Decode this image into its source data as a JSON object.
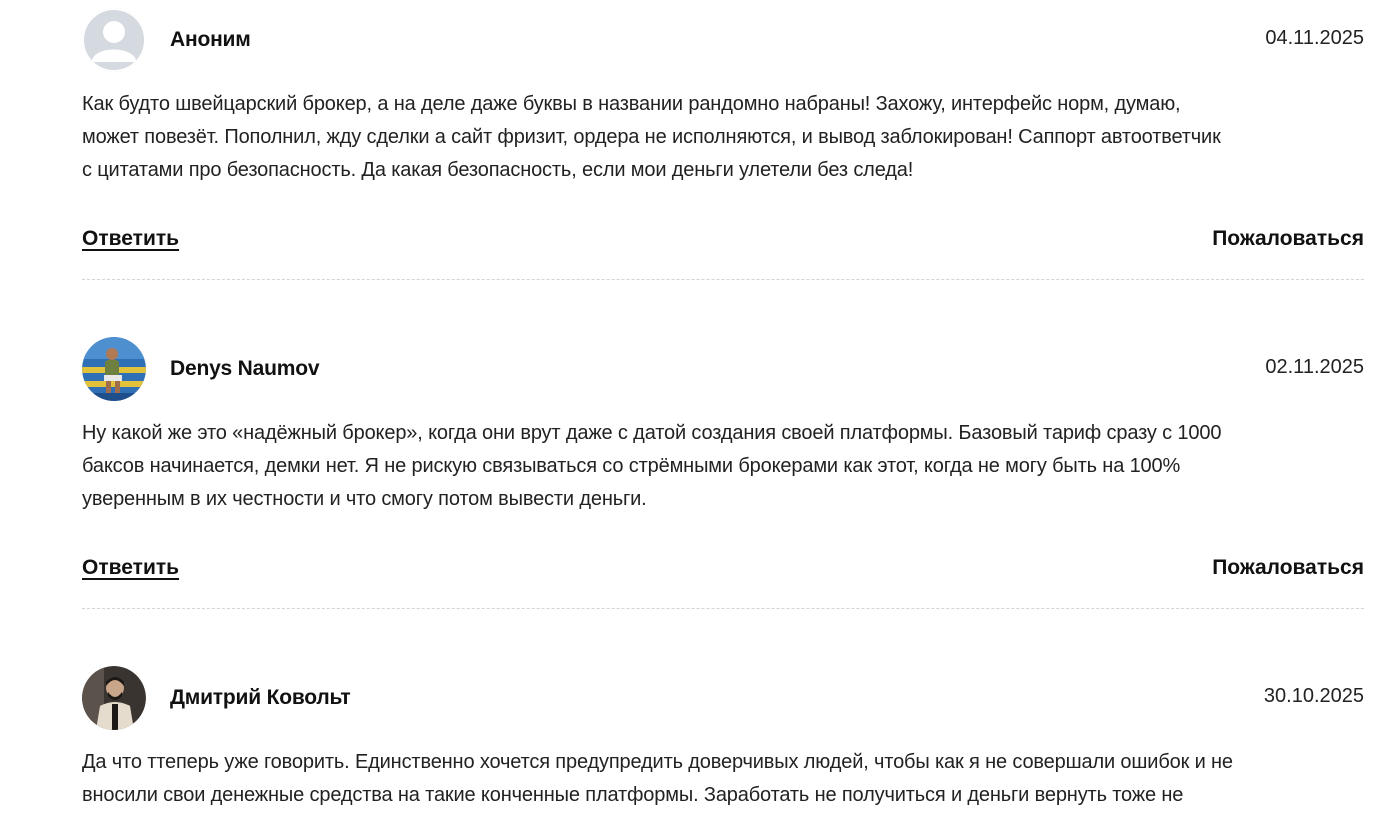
{
  "comments": [
    {
      "author": "Аноним",
      "date": "04.11.2025",
      "avatar": "anonymous-user-icon",
      "text_lines": [
        "Как будто швейцарский брокер, а на деле даже буквы в названии рандомно набраны! Захожу, интерфейс норм, думаю,",
        "может повезёт. Пополнил, жду сделки а сайт фризит, ордера не исполняются, и вывод заблокирован! Саппорт автоответчик",
        "с цитатами про безопасность. Да какая безопасность, если мои деньги улетели без следа!"
      ],
      "reply_label": "Ответить",
      "report_label": "Пожаловаться"
    },
    {
      "author": "Denys Naumov",
      "date": "02.11.2025",
      "avatar": "user-photo",
      "text_lines": [
        "Ну какой же это «надёжный брокер», когда они врут даже с датой создания своей платформы. Базовый тариф сразу с 1000",
        "баксов начинается, демки нет. Я не рискую связываться со стрёмными брокерами как этот, когда не могу быть на 100%",
        "уверенным в их честности и что смогу потом вывести деньги."
      ],
      "reply_label": "Ответить",
      "report_label": "Пожаловаться"
    },
    {
      "author": "Дмитрий Ковольт",
      "date": "30.10.2025",
      "avatar": "user-photo",
      "text_lines": [
        "Да что ттеперь уже говорить. Единственно хочется предупредить доверчивых людей, чтобы как я не совершали ошибок и не",
        "вносили свои денежные средства на такие конченные платформы. Заработать не получиться и деньги вернуть тоже не"
      ]
    }
  ],
  "colors": {
    "divider": "#d4d4d4",
    "anon_avatar_bg": "#d5d9e0",
    "anon_avatar_fg": "#ffffff"
  }
}
